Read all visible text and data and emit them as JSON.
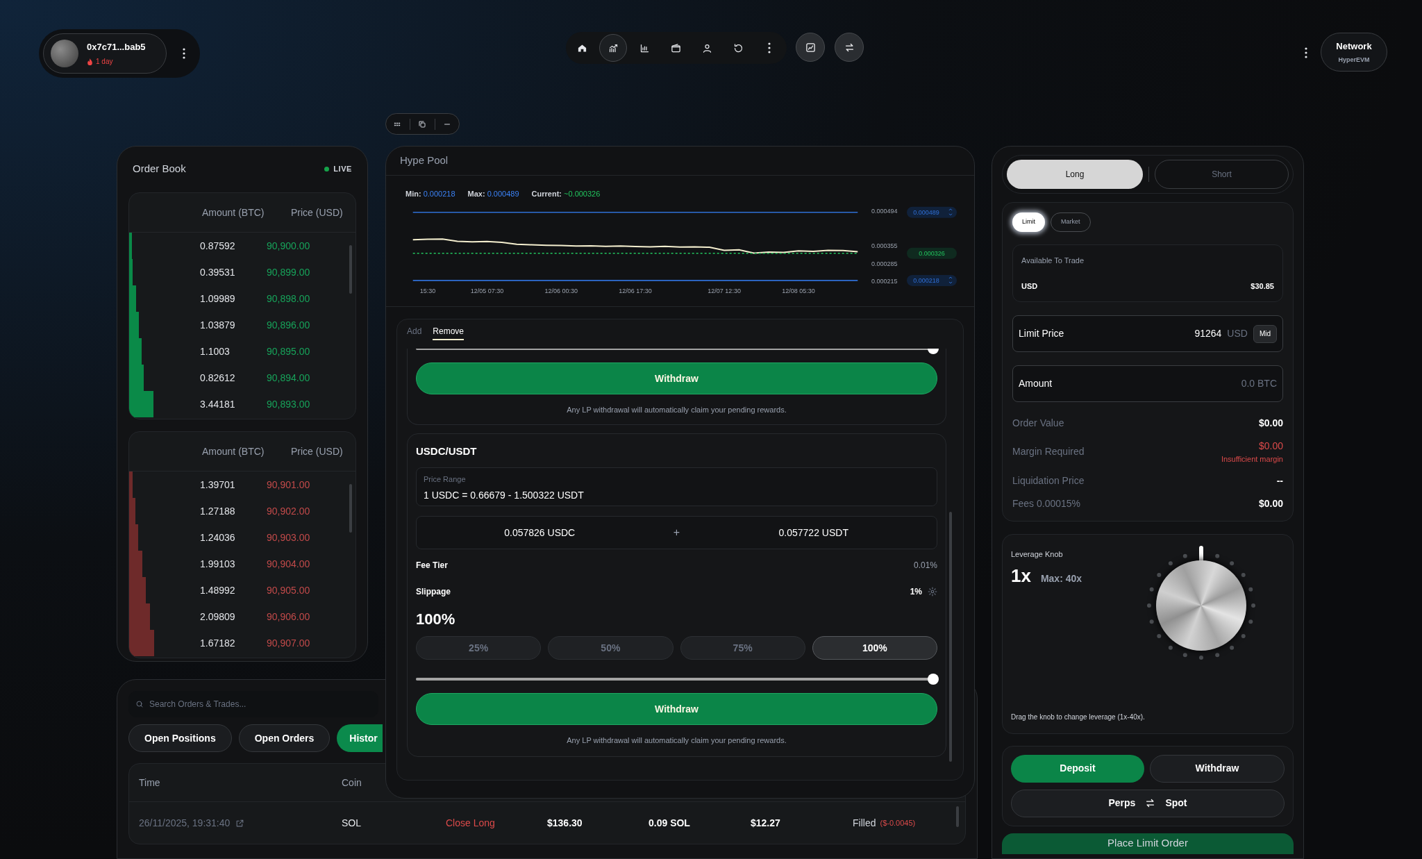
{
  "account": {
    "address": "0x7c71...bab5",
    "streak": "1 day"
  },
  "nav_items": [
    {
      "selected": false
    },
    {
      "selected": true
    },
    {
      "selected": false
    },
    {
      "selected": false
    },
    {
      "selected": false
    },
    {
      "selected": false
    },
    {
      "selected": false
    }
  ],
  "network": {
    "label": "Network",
    "value": "HyperEVM"
  },
  "order_book": {
    "title": "Order Book",
    "status": "LIVE",
    "bids": {
      "columns": [
        "Amount (BTC)",
        "Price (USD)"
      ],
      "rows": [
        {
          "amount": "0.87592",
          "price": "90,900.00"
        },
        {
          "amount": "0.39531",
          "price": "90,899.00"
        },
        {
          "amount": "1.09989",
          "price": "90,898.00"
        },
        {
          "amount": "1.03879",
          "price": "90,896.00"
        },
        {
          "amount": "1.1003",
          "price": "90,895.00"
        },
        {
          "amount": "0.82612",
          "price": "90,894.00"
        },
        {
          "amount": "3.44181",
          "price": "90,893.00"
        }
      ]
    },
    "asks": {
      "columns": [
        "Amount (BTC)",
        "Price (USD)"
      ],
      "rows": [
        {
          "amount": "1.39701",
          "price": "90,901.00"
        },
        {
          "amount": "1.27188",
          "price": "90,902.00"
        },
        {
          "amount": "1.24036",
          "price": "90,903.00"
        },
        {
          "amount": "1.99103",
          "price": "90,904.00"
        },
        {
          "amount": "1.48992",
          "price": "90,905.00"
        },
        {
          "amount": "2.09809",
          "price": "90,906.00"
        },
        {
          "amount": "1.67182",
          "price": "90,907.00"
        }
      ]
    }
  },
  "pool": {
    "title": "Hype Pool",
    "range": {
      "min_label": "Min:",
      "min": "0.000218",
      "max_label": "Max:",
      "max": "0.000489",
      "current_label": "Current:",
      "current": "~0.000326"
    },
    "chart_data": {
      "type": "line",
      "categories": [
        null,
        "15:30",
        null,
        null,
        null,
        "12/05 07:30",
        null,
        null,
        null,
        null,
        "12/06 00:30",
        null,
        null,
        null,
        null,
        "12/06 17:30",
        null,
        null,
        null,
        null,
        null,
        "12/07 12:30",
        null,
        null,
        null,
        null,
        "12/08 05:30",
        null,
        null,
        null,
        null
      ],
      "series": [
        {
          "color": "#f5efcf",
          "line_style": "solid",
          "values": [
            0.00038,
            0.000382,
            0.000383,
            0.000374,
            0.000372,
            0.000373,
            0.00037,
            0.000362,
            0.00036,
            0.000358,
            0.000357,
            0.000355,
            0.000356,
            0.000354,
            0.000355,
            0.000353,
            0.000352,
            0.000354,
            0.000351,
            0.000352,
            0.00035,
            0.000338,
            0.00034,
            0.000327,
            0.000331,
            0.00033,
            0.000336,
            0.000334,
            0.000338,
            0.000337,
            0.000332
          ]
        },
        {
          "name": "0.000489",
          "color": "#2f6fd6",
          "line_style": "solid",
          "values": [
            0.000489,
            0.000489,
            0.000489,
            0.000489,
            0.000489,
            0.000489,
            0.000489,
            0.000489,
            0.000489,
            0.000489,
            0.000489,
            0.000489,
            0.000489,
            0.000489,
            0.000489,
            0.000489,
            0.000489,
            0.000489,
            0.000489,
            0.000489,
            0.000489,
            0.000489,
            0.000489,
            0.000489,
            0.000489,
            0.000489,
            0.000489,
            0.000489,
            0.000489,
            0.000489,
            0.000489
          ]
        },
        {
          "name": "0.000326",
          "color": "#22c55e",
          "line_style": "dashed",
          "values": [
            0.000326,
            0.000326,
            0.000326,
            0.000326,
            0.000326,
            0.000326,
            0.000326,
            0.000326,
            0.000326,
            0.000326,
            0.000326,
            0.000326,
            0.000326,
            0.000326,
            0.000326,
            0.000326,
            0.000326,
            0.000326,
            0.000326,
            0.000326,
            0.000326,
            0.000326,
            0.000326,
            0.000326,
            0.000326,
            0.000326,
            0.000326,
            0.000326,
            0.000326,
            0.000326,
            0.000326
          ]
        },
        {
          "name": "0.000218",
          "color": "#2f6fd6",
          "line_style": "solid",
          "values": [
            0.000218,
            0.000218,
            0.000218,
            0.000218,
            0.000218,
            0.000218,
            0.000218,
            0.000218,
            0.000218,
            0.000218,
            0.000218,
            0.000218,
            0.000218,
            0.000218,
            0.000218,
            0.000218,
            0.000218,
            0.000218,
            0.000218,
            0.000218,
            0.000218,
            0.000218,
            0.000218,
            0.000218,
            0.000218,
            0.000218,
            0.000218,
            0.000218,
            0.000218,
            0.000218,
            0.000218
          ]
        }
      ],
      "ylim": [
        0.000215,
        0.000494
      ],
      "yticks": [
        {
          "value": 0.000494,
          "label": "0.000494"
        },
        {
          "value": 0.000355,
          "label": "0.000355"
        },
        {
          "value": 0.000285,
          "label": "0.000285"
        },
        {
          "value": 0.000215,
          "label": "0.000215"
        }
      ],
      "legend": "right"
    },
    "tabs": [
      {
        "label": "Add",
        "selected": false
      },
      {
        "label": "Remove",
        "selected": true
      }
    ],
    "previous_card": {
      "slider": {
        "level": 1
      },
      "button": "Withdraw",
      "note": "Any LP withdrawal will automatically claim your pending rewards."
    },
    "position": {
      "pair": "USDC/USDT",
      "price_range_label": "Price Range",
      "price_range": "1 USDC = 0.66679 - 1.500322 USDT",
      "amounts": [
        "0.057826 USDC",
        "0.057722 USDT"
      ],
      "plus": "+",
      "fee_tier": {
        "label": "Fee Tier",
        "value": "0.01%"
      },
      "slippage": {
        "label": "Slippage",
        "value": "1%"
      },
      "percent": "100%",
      "presets": [
        {
          "label": "25%",
          "selected": false
        },
        {
          "label": "50%",
          "selected": false
        },
        {
          "label": "75%",
          "selected": false
        },
        {
          "label": "100%",
          "selected": true
        }
      ],
      "slider": {
        "level": 1
      },
      "button": "Withdraw",
      "note": "Any LP withdrawal will automatically claim your pending rewards."
    }
  },
  "trade": {
    "sides": [
      {
        "label": "Long",
        "selected": true
      },
      {
        "label": "Short",
        "selected": false
      }
    ],
    "order_types": [
      {
        "label": "Limit",
        "selected": true
      },
      {
        "label": "Market",
        "selected": false
      }
    ],
    "available": {
      "title": "Available To Trade",
      "currency": "USD",
      "amount": "$30.85"
    },
    "limit_price": {
      "label": "Limit Price",
      "value": "91264",
      "unit": "USD",
      "button": "Mid"
    },
    "amount": {
      "label": "Amount",
      "placeholder": "0.0 BTC"
    },
    "summary": [
      {
        "label": "Order Value",
        "value": "$0.00"
      },
      {
        "label": "Margin Required",
        "value": "$0.00",
        "warning": "Insufficient margin"
      },
      {
        "label": "Liquidation Price",
        "value": "--"
      },
      {
        "label": "Fees 0.00015%",
        "value": "$0.00"
      }
    ],
    "leverage": {
      "title": "Leverage Knob",
      "value": "1x",
      "max": "Max: 40x",
      "hint": "Drag the knob to change leverage (1x-40x)."
    },
    "deposit": "Deposit",
    "withdraw": "Withdraw",
    "perps": "Perps",
    "spot": "Spot",
    "place_order": "Place Limit Order"
  },
  "history": {
    "search_placeholder": "Search Orders & Trades...",
    "tabs": [
      {
        "label": "Open Positions",
        "selected": false
      },
      {
        "label": "Open Orders",
        "selected": false
      },
      {
        "label": "Histor",
        "selected": true
      }
    ],
    "columns": [
      "Time",
      "Coin"
    ],
    "rows": [
      {
        "time": "26/11/2025, 19:31:40",
        "coin": "SOL",
        "direction": "Close Long",
        "price": "$136.30",
        "size": "0.09 SOL",
        "value": "$12.27",
        "status": "Filled",
        "pnl": "($-0.0045)"
      }
    ]
  }
}
